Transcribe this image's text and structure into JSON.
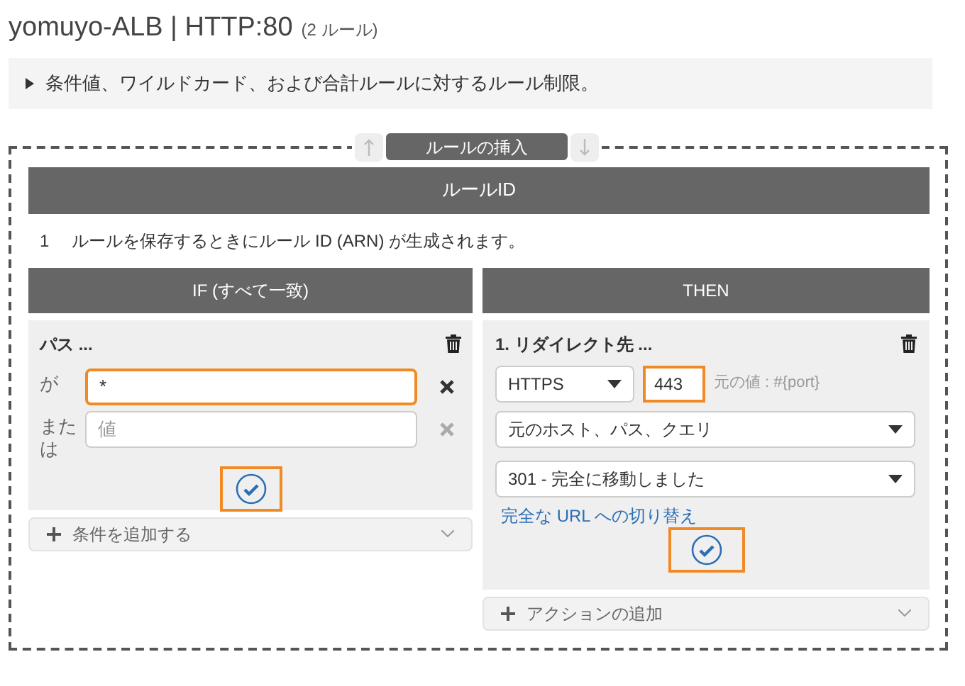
{
  "title": {
    "name": "yomuyo-ALB | HTTP:80",
    "count": "(2 ルール)"
  },
  "info": {
    "text": "条件値、ワイルドカード、および合計ルールに対するルール制限。",
    "expanded": false
  },
  "insert_bar": {
    "label": "ルールの挿入"
  },
  "rule_id": {
    "header": "ルールID",
    "number": "1",
    "text": "ルールを保存するときにルール ID (ARN) が生成されます。"
  },
  "if_column": {
    "header": "IF (すべて一致)",
    "condition_title": "パス ...",
    "values": [
      {
        "label": "が",
        "value": "*",
        "focused": true
      },
      {
        "label": "または",
        "placeholder": "値",
        "focused": false
      }
    ],
    "add_label": "条件を追加する"
  },
  "then_column": {
    "header": "THEN",
    "action_title": "1. リダイレクト先 ...",
    "protocol": "HTTPS",
    "port": "443",
    "port_hint": "元の値 : #{port}",
    "target": "元のホスト、パス、クエリ",
    "status_code": "301 - 完全に移動しました",
    "link": "完全な URL への切り替え",
    "add_label": "アクションの追加"
  }
}
